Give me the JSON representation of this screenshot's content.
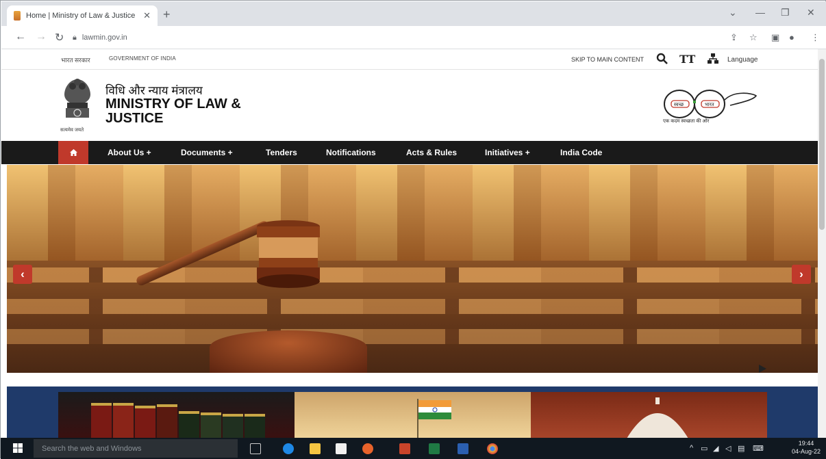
{
  "browser": {
    "tab_title": "Home | Ministry of Law & Justice",
    "url": "lawmin.gov.in"
  },
  "govbar": {
    "hindi": "भारत सरकार",
    "english": "GOVERNMENT OF INDIA",
    "skip": "SKIP TO MAIN CONTENT",
    "font_icon": "TT",
    "language": "Language"
  },
  "header": {
    "hindi_title": "विधि और न्याय मंत्रालय",
    "title": "MINISTRY OF LAW & JUSTICE",
    "emblem_motto": "सत्यमेव जयते",
    "swachh_left": "स्वच्छ",
    "swachh_right": "भारत",
    "swachh_tagline": "एक कदम स्वच्छता की ओर"
  },
  "nav": {
    "items": [
      "About Us +",
      "Documents +",
      "Tenders",
      "Notifications",
      "Acts & Rules",
      "Initiatives +",
      "India Code"
    ]
  },
  "carousel": {
    "prev": "‹",
    "next": "›"
  },
  "taskbar": {
    "search_placeholder": "Search the web and Windows",
    "time": "19:44",
    "date": "04-Aug-22"
  },
  "colors": {
    "nav_bg": "#1a1a1a",
    "accent_red": "#c0392b",
    "band_blue": "#1f3a6a"
  }
}
